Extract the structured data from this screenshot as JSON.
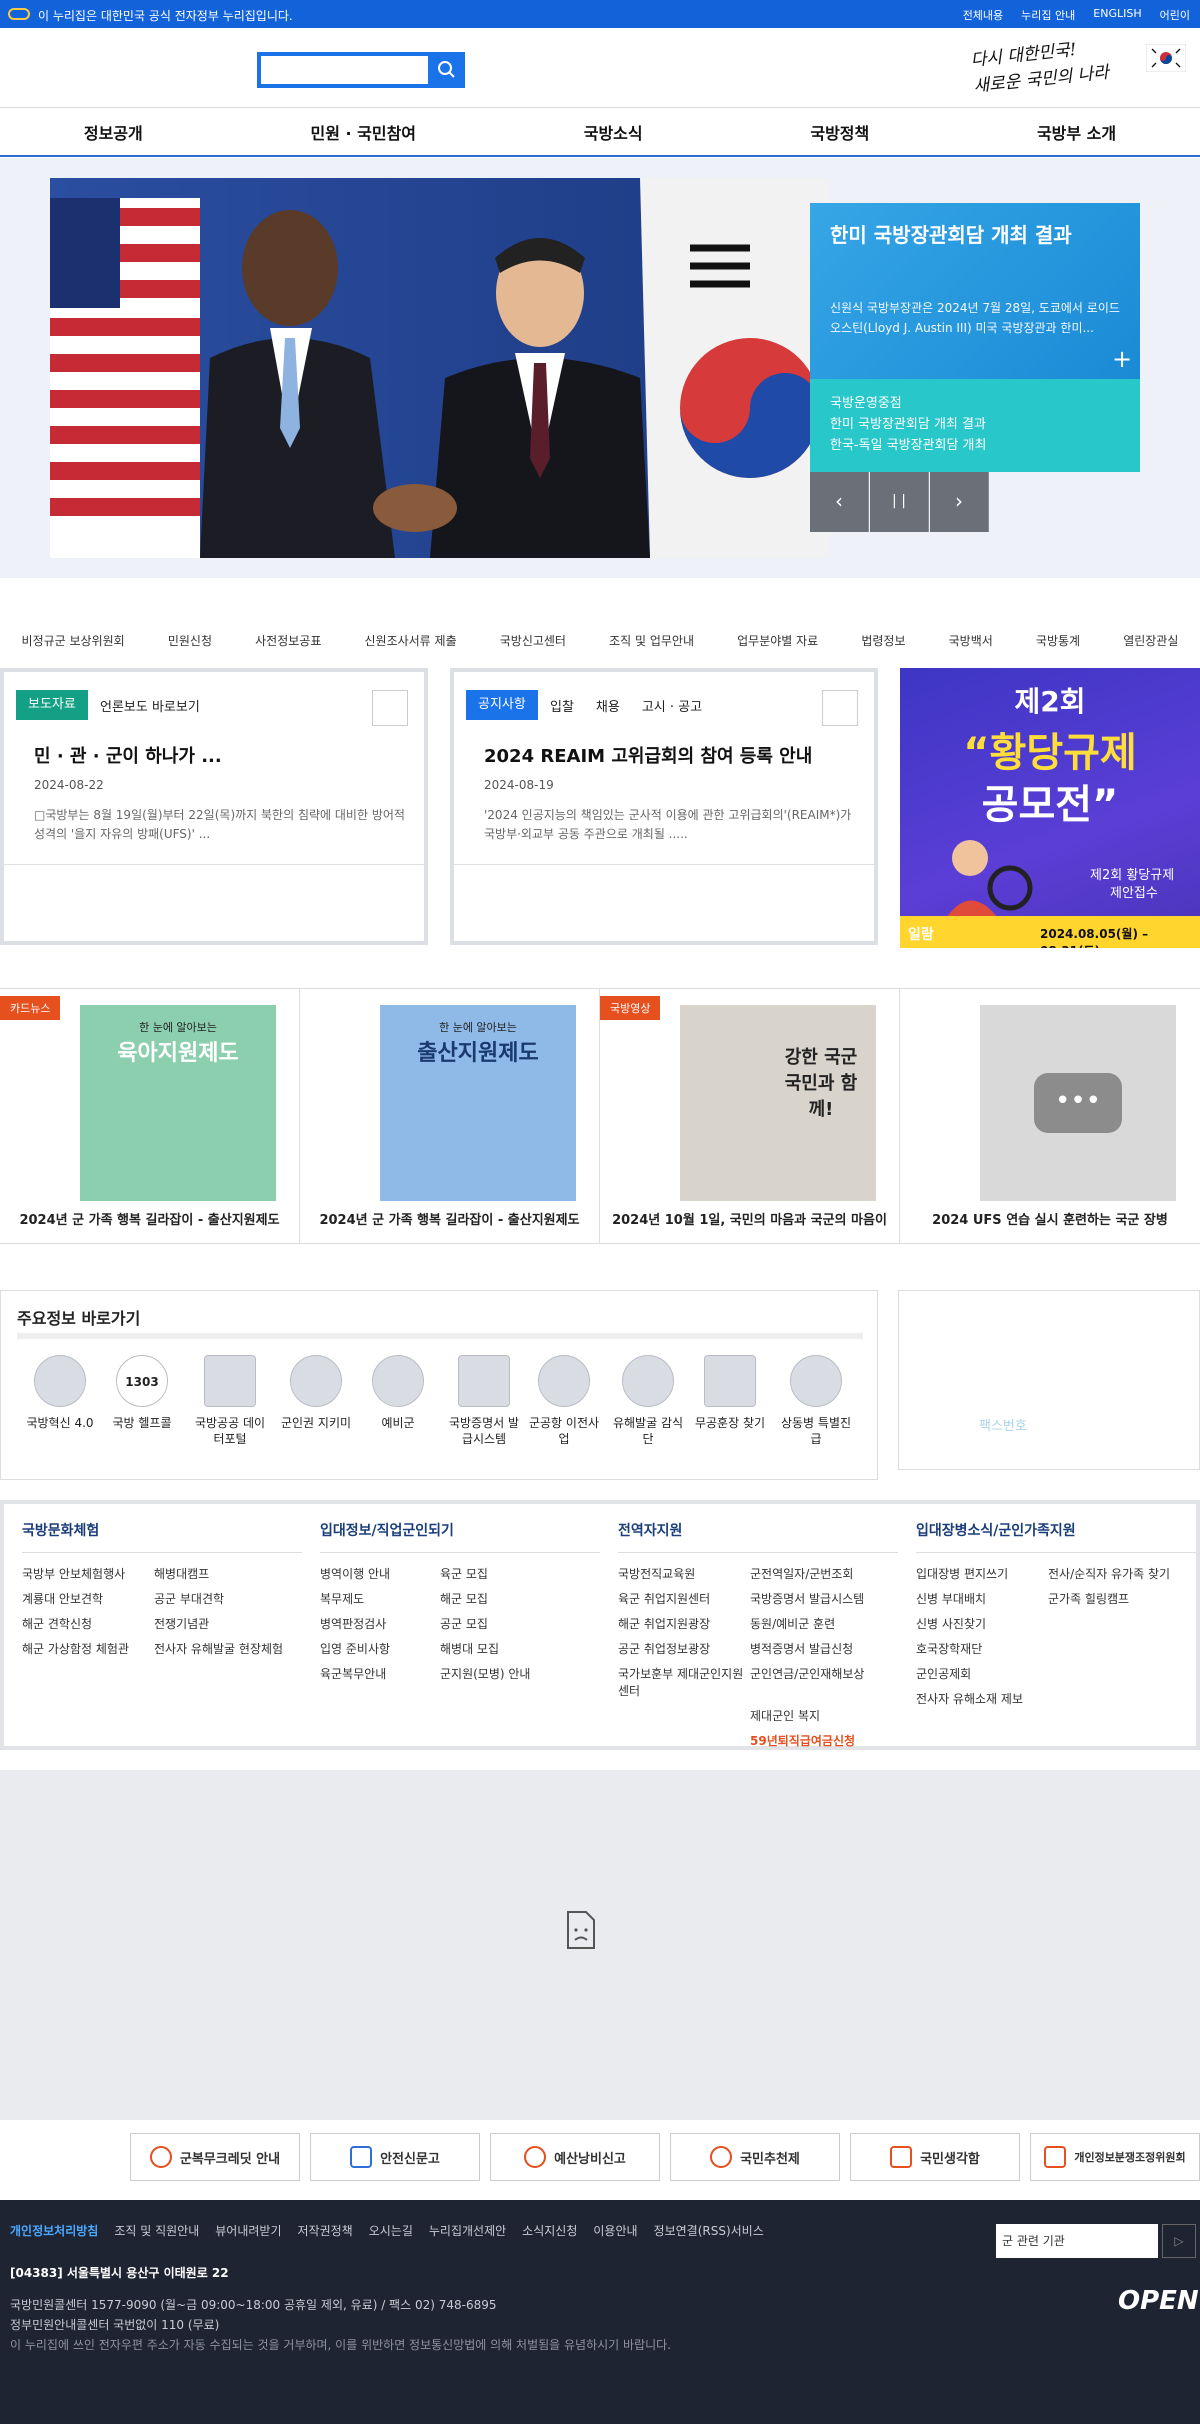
{
  "topbar": {
    "notice": "이 누리집은 대한민국 공식 전자정부 누리집입니다.",
    "links": [
      "전체내용",
      "누리집 안내",
      "ENGLISH",
      "어린이"
    ]
  },
  "header": {
    "slogan_line1": "다시 대한민국!",
    "slogan_line2": "새로운 국민의 나라"
  },
  "nav": [
    "정보공개",
    "민원 · 국민참여",
    "국방소식",
    "국방정책",
    "국방부 소개"
  ],
  "hero": {
    "title": "한미 국방장관회담 개최 결과",
    "desc": "신원식 국방부장관은 2024년 7월 28일, 도쿄에서 로이드 오스틴(Lloyd J. Austin III) 미국 국방장관과 한미...",
    "plus": "+",
    "sub": [
      "국방운영중점",
      "한미 국방장관회담 개최 결과",
      "한국-독일 국방장관회담 개최"
    ],
    "controls": [
      "‹",
      "| |",
      "›"
    ]
  },
  "quick_links": [
    "비정규군 보상위원회",
    "민원신청",
    "사전정보공표",
    "신원조사서류 제출",
    "국방신고센터",
    "조직 및 업무안내",
    "업무분야별 자료",
    "법령정보",
    "국방백서",
    "국방통계",
    "열린장관실"
  ],
  "press": {
    "tag": "보도자료",
    "tab": "언론보도 바로보기",
    "title": "민 · 관 · 군이 하나가 ...",
    "date": "2024-08-22",
    "summary": "□국방부는 8월 19일(월)부터 22일(목)까지 북한의 침략에 대비한 방어적 성격의 '을지 자유의 방패(UFS)' ..."
  },
  "notice": {
    "tag": "공지사항",
    "tabs": [
      "입찰",
      "채용",
      "고시 · 공고"
    ],
    "title": "2024 REAIM 고위급회의 참여 등록 안내",
    "date": "2024-08-19",
    "summary": "'2024 인공지능의 책임있는 군사적 이용에 관한 고위급회의'(REAIM*)가 국방부·외교부 공동 주관으로 개최될 ....."
  },
  "promo": {
    "line1": "제2회",
    "line2": "“황당규제",
    "line3": "공모전”",
    "sub1": "제2회 황당규제",
    "sub2": "제안접수",
    "label": "일람",
    "period": "2024.08.05(월) – 08.31(토)"
  },
  "thumbs": [
    {
      "badge": "카드뉴스",
      "caption": "2024년 군 가족 행복 길라잡이 - 출산지원제도",
      "img_title": "육아지원제도",
      "img_top": "한 눈에 알아보는"
    },
    {
      "badge": "",
      "caption": "2024년 군 가족 행복 길라잡이 - 출산지원제도",
      "img_title": "출산지원제도",
      "img_top": "한 눈에 알아보는"
    },
    {
      "badge": "국방영상",
      "caption": "2024년 10월 1일, 국민의 마음과 국군의 마음이",
      "img_title": "강한 국군 국민과 함께!",
      "img_top": ""
    },
    {
      "badge": "",
      "caption": "2024 UFS 연습 실시 훈련하는 국군 장병",
      "img_title": "",
      "img_top": ""
    }
  ],
  "info": {
    "heading": "주요정보 바로가기",
    "items": [
      "국방혁신 4.0",
      "국방 헬프콜",
      "국방공공 데이터포털",
      "군인권 지키미",
      "예비군",
      "국방증명서 발급시스템",
      "군공항 이전사업",
      "유해발굴 감식단",
      "무공훈장 찾기",
      "상동병 특별진급"
    ],
    "helpcall_num": "1303"
  },
  "side_box": {
    "text": "팩스번호"
  },
  "link_cols": [
    {
      "heading": "국방문화체험",
      "items": [
        "국방부 안보체험행사",
        "해병대캠프",
        "계룡대 안보견학",
        "공군 부대견학",
        "해군 견학신청",
        "전쟁기념관",
        "해군 가상함정 체험관",
        "전사자 유해발굴 현장체험"
      ]
    },
    {
      "heading": "입대정보/직업군인되기",
      "items": [
        "병역이행 안내",
        "육군 모집",
        "복무제도",
        "해군 모집",
        "병역판정검사",
        "공군 모집",
        "입영 준비사항",
        "해병대 모집",
        "육군복무안내",
        "군지원(모병) 안내"
      ]
    },
    {
      "heading": "전역자지원",
      "items": [
        "국방전직교육원",
        "군전역일자/군번조회",
        "육군 취업지원센터",
        "국방증명서 발급시스템",
        "해군 취업지원광장",
        "동원/예비군 훈련",
        "공군 취업정보광장",
        "병적증명서 발급신청",
        "국가보훈부 제대군인지원센터",
        "군인연금/군인재해보상",
        "",
        "제대군인 복지",
        "",
        "59년퇴직급여금신청"
      ]
    },
    {
      "heading": "입대장병소식/군인가족지원",
      "items": [
        "입대장병 편지쓰기",
        "전사/순직자 유가족 찾기",
        "신병 부대배치",
        "군가족 힐링캠프",
        "신병 사진찾기",
        "",
        "호국장학재단",
        "",
        "군인공제회",
        "",
        "전사자 유해소재 제보",
        ""
      ]
    }
  ],
  "banners": [
    "군복무크레딧 안내",
    "안전신문고",
    "예산낭비신고",
    "국민추천제",
    "국민생각함",
    "개인정보분쟁조정위원회"
  ],
  "footer": {
    "menu": [
      "개인정보처리방침",
      "조직 및 직원안내",
      "뷰어내려받기",
      "저작권정책",
      "오시는길",
      "누리집개선제안",
      "소식지신청",
      "이용안내",
      "정보연결(RSS)서비스"
    ],
    "address": "[04383] 서울특별시 용산구 이태원로 22",
    "tel": "국방민원콜센터 1577-9090 (월~금 09:00~18:00 공휴일 제외, 유료) / 팩스 02) 748-6895",
    "tel2": "정부민원안내콜센터 국번없이 110 (무료)",
    "copy": "이 누리집에 쓰인 전자우편 주소가 자동 수집되는 것을 거부하며, 이를 위반하면 정보통신망법에 의해 처벌됨을 유념하시기 바랍니다.",
    "select": "군 관련 기관",
    "select_btn": "▷",
    "open": "OPEN"
  },
  "colors": {
    "primary": "#1262d9",
    "teal": "#14a085",
    "orange": "#e5501e"
  }
}
